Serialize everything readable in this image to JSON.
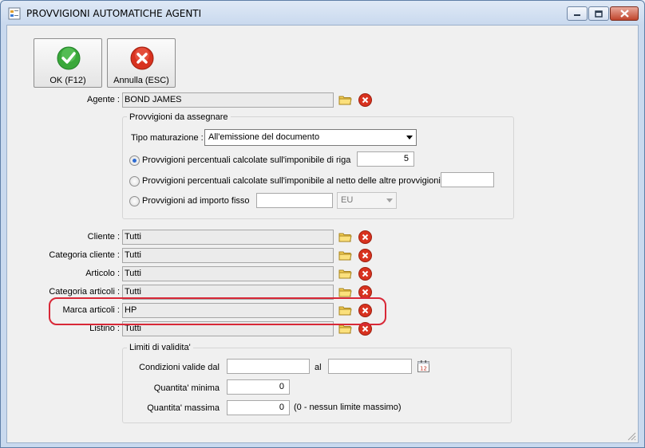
{
  "window": {
    "title": "PROVVIGIONI AUTOMATICHE AGENTI",
    "controls": {
      "minimize": "minimize",
      "maximize": "maximize",
      "close": "close"
    }
  },
  "toolbar": {
    "ok_label": "OK (F12)",
    "cancel_label": "Annulla (ESC)"
  },
  "agente": {
    "label": "Agente :",
    "value": "BOND JAMES"
  },
  "provvigioni": {
    "group_title": "Provvigioni da assegnare",
    "tipo_label": "Tipo maturazione :",
    "tipo_value": "All'emissione del documento",
    "option1_label": "Provvigioni percentuali calcolate sull'imponibile di riga",
    "option1_value": "5",
    "option2_label": "Provvigioni percentuali calcolate sull'imponibile al netto delle altre provvigioni",
    "option2_value": "",
    "option3_label": "Provvigioni ad importo fisso",
    "option3_value": "",
    "currency": "EU",
    "selected_option": 1
  },
  "filters": [
    {
      "label": "Cliente :",
      "value": "Tutti"
    },
    {
      "label": "Categoria cliente :",
      "value": "Tutti"
    },
    {
      "label": "Articolo :",
      "value": "Tutti"
    },
    {
      "label": "Categoria articoli :",
      "value": "Tutti"
    },
    {
      "label": "Marca articoli :",
      "value": "HP"
    },
    {
      "label": "Listino :",
      "value": "Tutti"
    }
  ],
  "limiti": {
    "group_title": "Limiti di validita'",
    "condizioni_label": "Condizioni valide dal",
    "dal_value": "",
    "al_label": "al",
    "al_value": "",
    "qmin_label": "Quantita' minima",
    "qmin_value": "0",
    "qmax_label": "Quantita' massima",
    "qmax_value": "0",
    "qmax_note": "(0 - nessun limite massimo)"
  },
  "colors": {
    "highlight": "#d82837",
    "ok_green": "#3aa83a",
    "cancel_red": "#d8321f",
    "radio_selected": "#2e6bd1"
  }
}
